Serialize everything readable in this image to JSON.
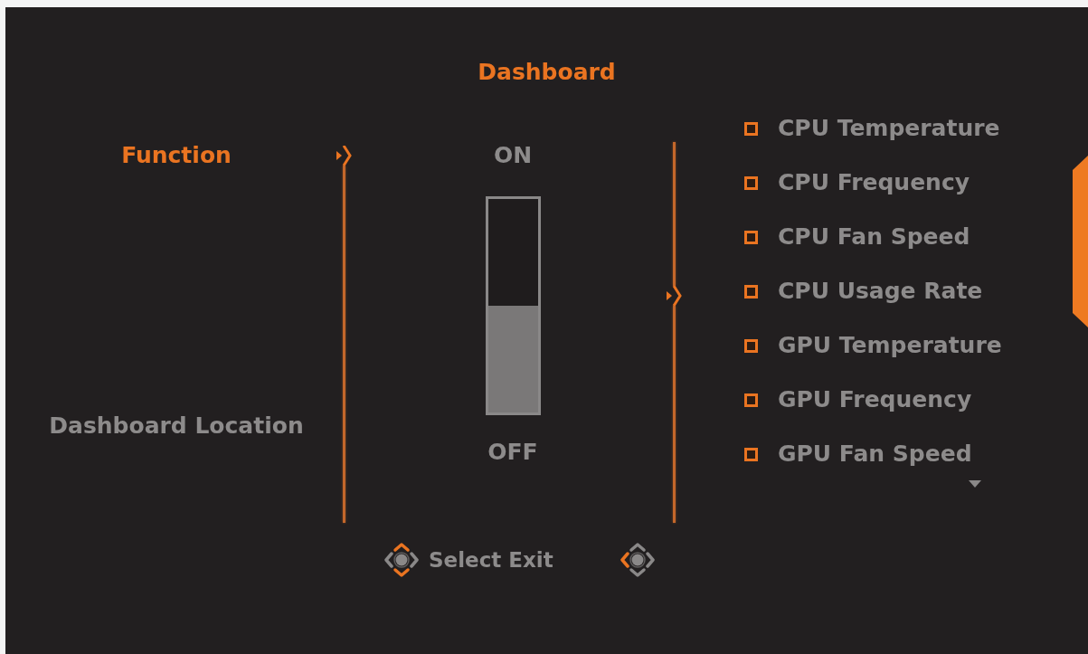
{
  "title": "Dashboard",
  "menu": [
    {
      "label": "Function",
      "selected": true
    },
    {
      "label": "Dashboard Location",
      "selected": false
    }
  ],
  "function_switch": {
    "on_label": "ON",
    "off_label": "OFF",
    "on": false
  },
  "dashboard_items": [
    {
      "label": "CPU Temperature",
      "checked": false
    },
    {
      "label": "CPU Frequency",
      "checked": false
    },
    {
      "label": "CPU Fan Speed",
      "checked": false
    },
    {
      "label": "CPU Usage Rate",
      "checked": false
    },
    {
      "label": "GPU Temperature",
      "checked": false
    },
    {
      "label": "GPU Frequency",
      "checked": false
    },
    {
      "label": "GPU Fan Speed",
      "checked": false
    }
  ],
  "footer": {
    "hint": "Select Exit",
    "pads": [
      {
        "up": true,
        "down": true,
        "left": false,
        "right": false
      },
      {
        "up": false,
        "down": false,
        "left": true,
        "right": false
      }
    ]
  }
}
